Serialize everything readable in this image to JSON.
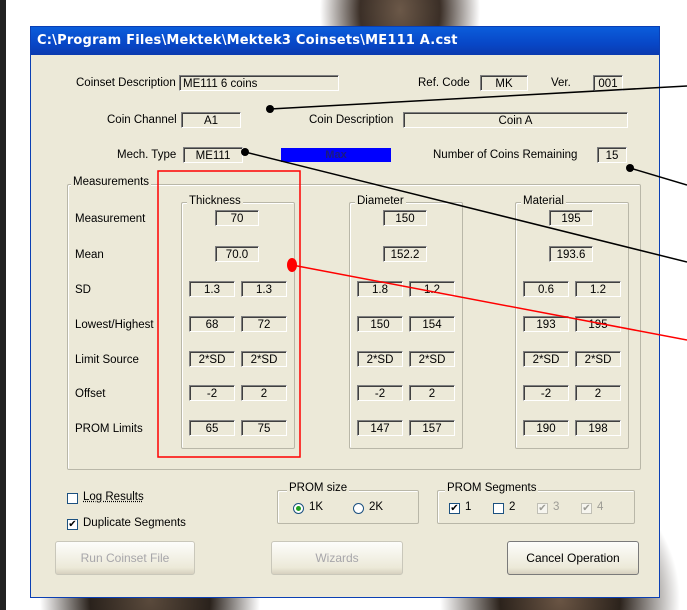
{
  "window": {
    "title": "C:\\Program Files\\Mektek\\Mektek3 Coinsets\\ME111 A.cst"
  },
  "header": {
    "coinset_description_label": "Coinset Description",
    "coinset_description_value": "ME111 6 coins",
    "ref_code_label": "Ref. Code",
    "ref_code_value": "MK",
    "ver_label": "Ver.",
    "ver_value": "001",
    "coin_channel_label": "Coin Channel",
    "coin_channel_value": "A1",
    "coin_description_label": "Coin Description",
    "coin_description_value": "Coin A",
    "mech_type_label": "Mech. Type",
    "mech_type_value": "ME111",
    "status_bar_text": "Max",
    "coins_remaining_label": "Number of Coins Remaining",
    "coins_remaining_value": "15"
  },
  "measurements": {
    "group_title": "Measurements",
    "row_labels": [
      "Measurement",
      "Mean",
      "SD",
      "Lowest/Highest",
      "Limit Source",
      "Offset",
      "PROM Limits"
    ],
    "columns": [
      {
        "title": "Thickness",
        "measurement": "70",
        "mean": "70.0",
        "sd": [
          "1.3",
          "1.3"
        ],
        "lowest_highest": [
          "68",
          "72"
        ],
        "limit_source": [
          "2*SD",
          "2*SD"
        ],
        "offset": [
          "-2",
          "2"
        ],
        "prom_limits": [
          "65",
          "75"
        ]
      },
      {
        "title": "Diameter",
        "measurement": "150",
        "mean": "152.2",
        "sd": [
          "1.8",
          "1.2"
        ],
        "lowest_highest": [
          "150",
          "154"
        ],
        "limit_source": [
          "2*SD",
          "2*SD"
        ],
        "offset": [
          "-2",
          "2"
        ],
        "prom_limits": [
          "147",
          "157"
        ]
      },
      {
        "title": "Material",
        "measurement": "195",
        "mean": "193.6",
        "sd": [
          "0.6",
          "1.2"
        ],
        "lowest_highest": [
          "193",
          "195"
        ],
        "limit_source": [
          "2*SD",
          "2*SD"
        ],
        "offset": [
          "-2",
          "2"
        ],
        "prom_limits": [
          "190",
          "198"
        ]
      }
    ]
  },
  "options": {
    "log_results_label": "Log Results",
    "log_results_checked": false,
    "duplicate_segments_label": "Duplicate Segments",
    "duplicate_segments_checked": true,
    "prom_size_title": "PROM size",
    "prom_size_options": [
      "1K",
      "2K"
    ],
    "prom_size_selected": "1K",
    "prom_segments_title": "PROM Segments",
    "prom_segments": [
      {
        "label": "1",
        "checked": true,
        "enabled": true
      },
      {
        "label": "2",
        "checked": false,
        "enabled": true
      },
      {
        "label": "3",
        "checked": true,
        "enabled": false
      },
      {
        "label": "4",
        "checked": true,
        "enabled": false
      }
    ]
  },
  "buttons": {
    "run_coinset": "Run Coinset File",
    "wizards": "Wizards",
    "cancel": "Cancel Operation"
  },
  "colors": {
    "title_bar": "#0a50d0",
    "status_bar": "#0000ff",
    "highlight": "#ff0000",
    "annotation_line": "#000000"
  }
}
